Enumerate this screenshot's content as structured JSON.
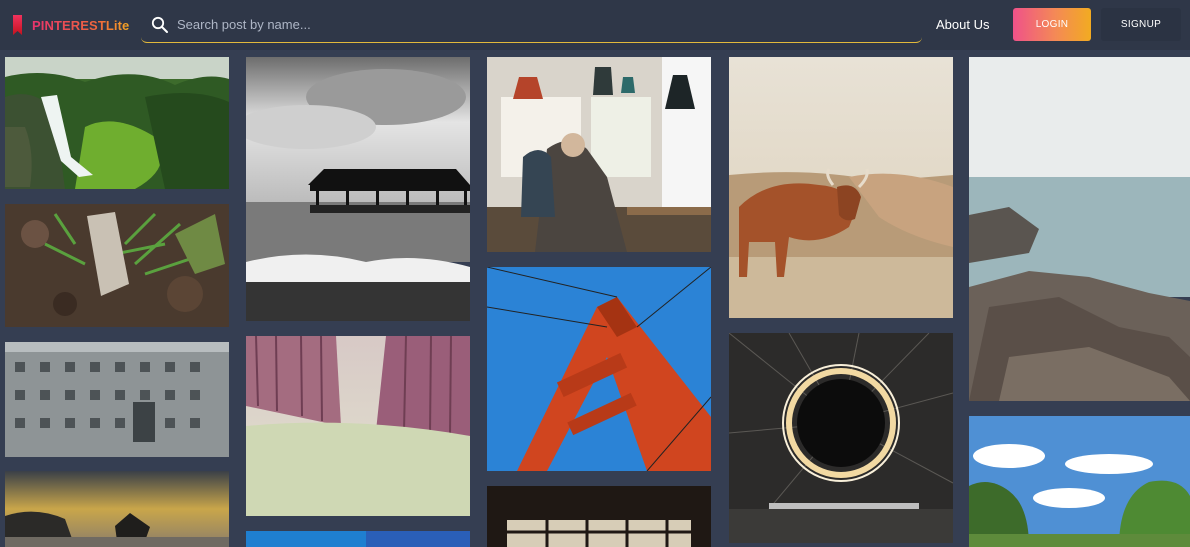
{
  "app": {
    "logo_text": "PINTERESTLite",
    "logo_icon": "bookmark-icon"
  },
  "search": {
    "placeholder": "Search post by name...",
    "value": "",
    "icon": "search-icon"
  },
  "nav": {
    "about_label": "About Us",
    "login_label": "LOGIN",
    "signup_label": "SIGNUP"
  },
  "colors": {
    "page_background": "#353e52",
    "navbar_background": "#2f3748",
    "search_underline": "#e2b93b",
    "login_gradient_start": "#ef5289",
    "login_gradient_end": "#f2ab21",
    "logo_gradient_start": "#e8336d",
    "logo_gradient_end": "#f5a623"
  },
  "gallery": {
    "columns": 5,
    "posts": [
      {
        "id": "waterfall",
        "column": 1
      },
      {
        "id": "plant-on-soil",
        "column": 1
      },
      {
        "id": "concrete-building",
        "column": 1
      },
      {
        "id": "rocky-beach-sunset",
        "column": 1
      },
      {
        "id": "black-white-pier",
        "column": 2
      },
      {
        "id": "pink-forest-path",
        "column": 2
      },
      {
        "id": "blue-texture",
        "column": 2
      },
      {
        "id": "cafe-interior",
        "column": 3
      },
      {
        "id": "golden-gate-tower",
        "column": 3
      },
      {
        "id": "window-silhouette",
        "column": 3
      },
      {
        "id": "highland-cow",
        "column": 4
      },
      {
        "id": "light-painting-ring",
        "column": 4
      },
      {
        "id": "ocean-rocks",
        "column": 5
      },
      {
        "id": "green-trees-sky",
        "column": 5
      }
    ]
  }
}
